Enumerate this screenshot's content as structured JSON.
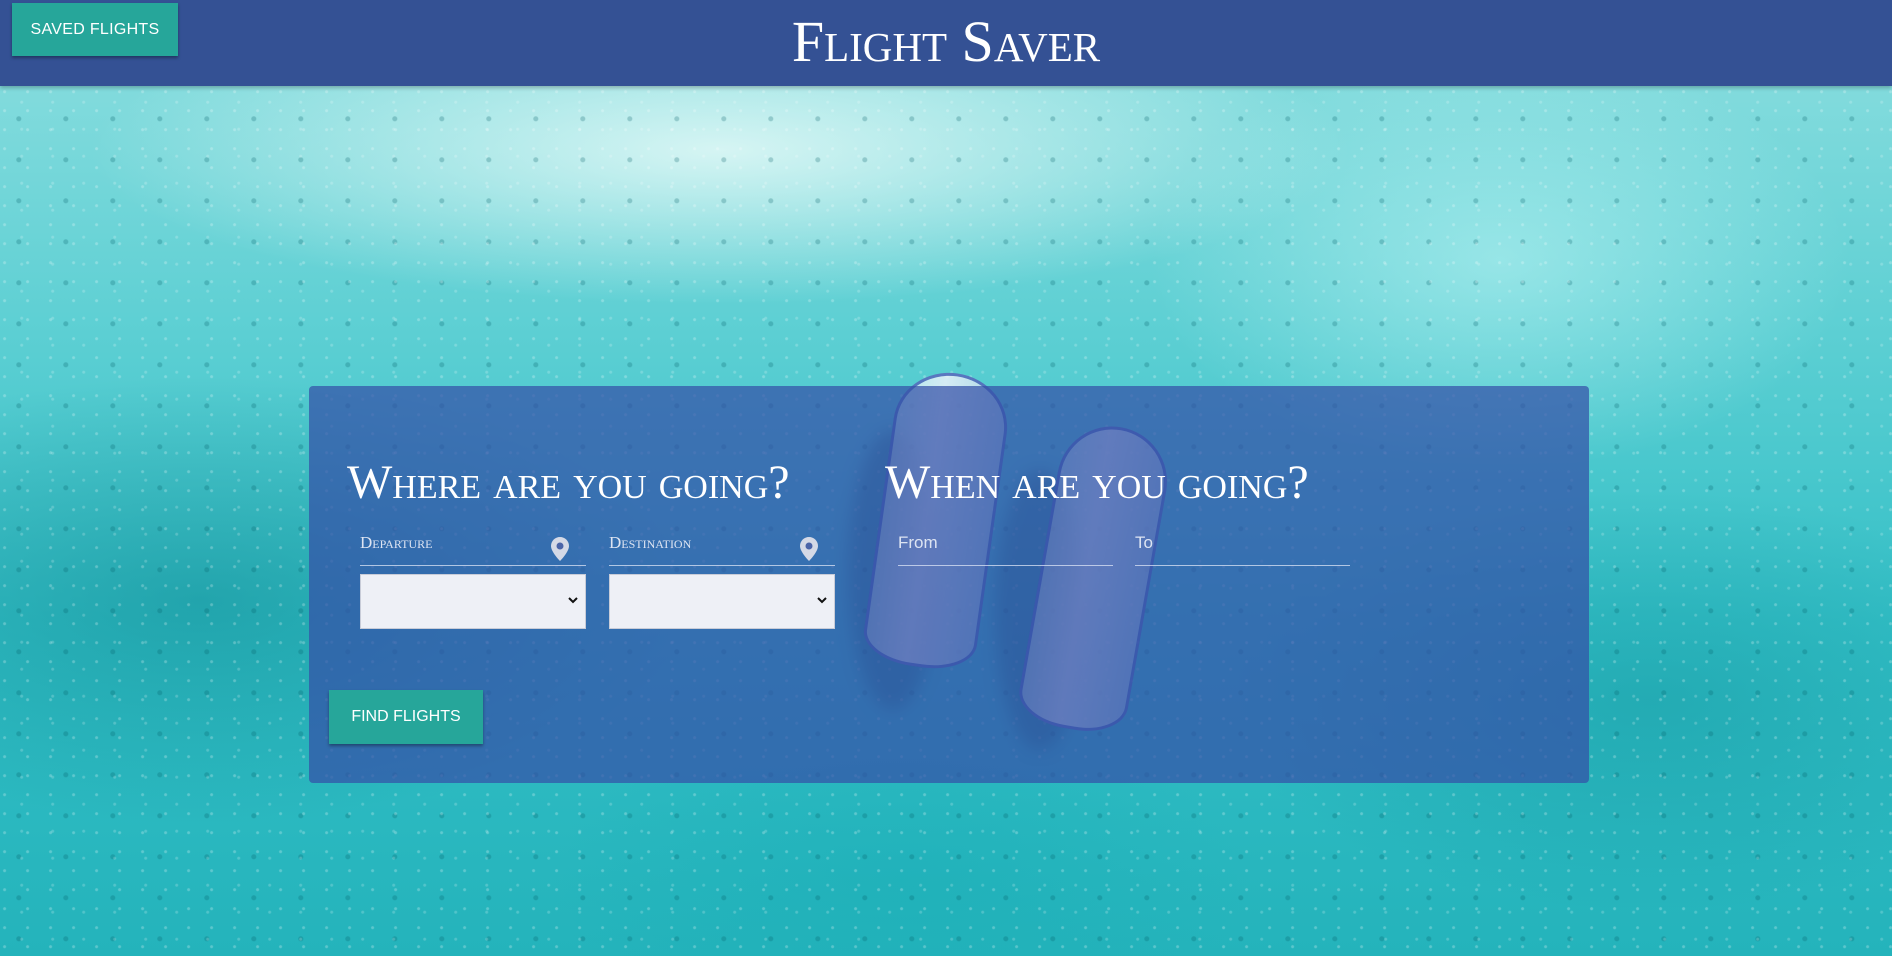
{
  "header": {
    "saved_flights_label": "SAVED FLIGHTS",
    "title": "Flight Saver"
  },
  "search": {
    "where_heading": "Where are you going?",
    "when_heading": "When are you going?",
    "departure_label": "Departure",
    "destination_label": "Destination",
    "from_label": "From",
    "to_label": "To",
    "departure_value": "",
    "destination_value": "",
    "find_flights_label": "FIND FLIGHTS"
  },
  "colors": {
    "navbar": "#345194",
    "accent_button": "#26a69a",
    "panel_overlay": "#3451a8"
  },
  "icons": {
    "departure": "location-pin-icon",
    "destination": "location-pin-icon",
    "select_arrow": "chevron-down-icon"
  }
}
